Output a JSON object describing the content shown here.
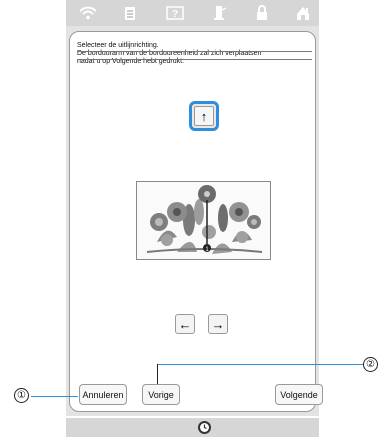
{
  "status_icons": [
    "wifi-icon",
    "document-icon",
    "help-icon",
    "thread-icon",
    "lock-icon",
    "home-icon"
  ],
  "instruction": {
    "line1": "Selecteer de uitlijnrichting.",
    "line2": "De borduurarm van de borduureenheid zal zich verplaatsen",
    "line3": "nadat u op Volgende hebt gedrukt."
  },
  "direction_buttons": {
    "up": "↑",
    "left": "←",
    "right": "→"
  },
  "embroidery_marker": "1",
  "buttons": {
    "cancel": "Annuleren",
    "previous": "Vorige",
    "next": "Volgende"
  },
  "callouts": {
    "one": "①",
    "two": "②"
  },
  "colors": {
    "accent": "#2f8fdc"
  }
}
